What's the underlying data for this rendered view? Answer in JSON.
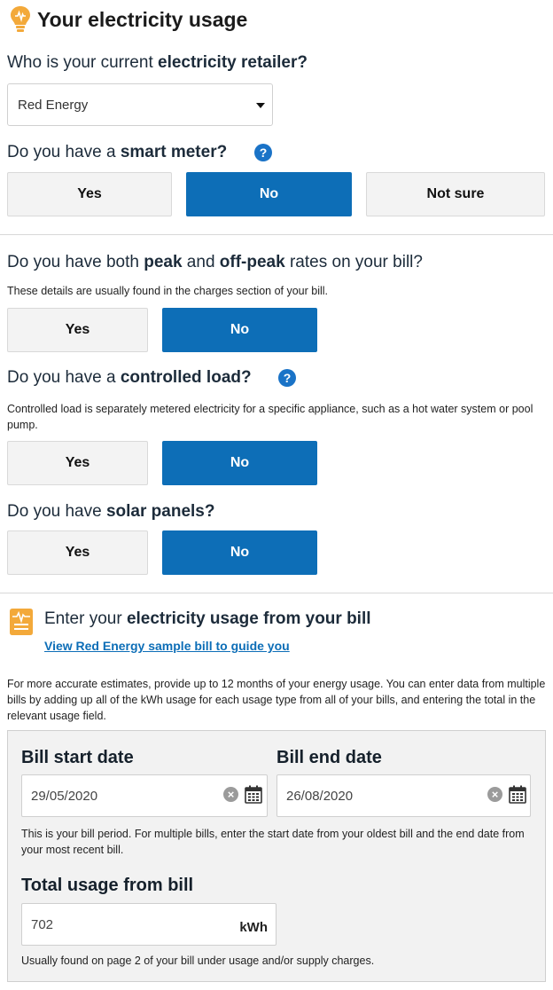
{
  "header": {
    "title": "Your electricity usage",
    "icon": "lightbulb-icon"
  },
  "retailer": {
    "question_pre": "Who is your current ",
    "question_bold": "electricity retailer?",
    "selected": "Red Energy"
  },
  "smart_meter": {
    "question_pre": "Do you have a ",
    "question_bold": "smart meter?",
    "help": "?",
    "options": [
      "Yes",
      "No",
      "Not sure"
    ],
    "selected": "No"
  },
  "peak": {
    "q1": "Do you have both ",
    "q2": "peak",
    "q3": " and ",
    "q4": "off-peak",
    "q5": " rates on your bill?",
    "hint": "These details are usually found in the charges section of your bill.",
    "options": [
      "Yes",
      "No"
    ],
    "selected": "No"
  },
  "controlled_load": {
    "question_pre": "Do you have a ",
    "question_bold": "controlled load?",
    "help": "?",
    "hint": "Controlled load is separately metered electricity for a specific appliance, such as a hot water system or pool pump.",
    "options": [
      "Yes",
      "No"
    ],
    "selected": "No"
  },
  "solar": {
    "question_pre": "Do you have ",
    "question_bold": "solar panels?",
    "options": [
      "Yes",
      "No"
    ],
    "selected": "No"
  },
  "usage": {
    "heading_pre": "Enter your ",
    "heading_bold": "electricity usage from your bill",
    "link": "View Red Energy sample bill to guide you",
    "intro": "For more accurate estimates, provide up to 12 months of your energy usage. You can enter data from multiple bills by adding up all of the kWh usage for each usage type from all of your bills, and entering the total in the relevant usage field.",
    "bill_start_label": "Bill start date",
    "bill_start_value": "29/05/2020",
    "bill_end_label": "Bill end date",
    "bill_end_value": "26/08/2020",
    "period_hint": "This is your bill period. For multiple bills, enter the start date from your oldest bill and the end date from your most recent bill.",
    "total_label": "Total usage from bill",
    "total_value": "702",
    "total_unit": "kWh",
    "total_hint": "Usually found on page 2 of your bill under usage and/or supply charges.",
    "clear_glyph": "×"
  }
}
